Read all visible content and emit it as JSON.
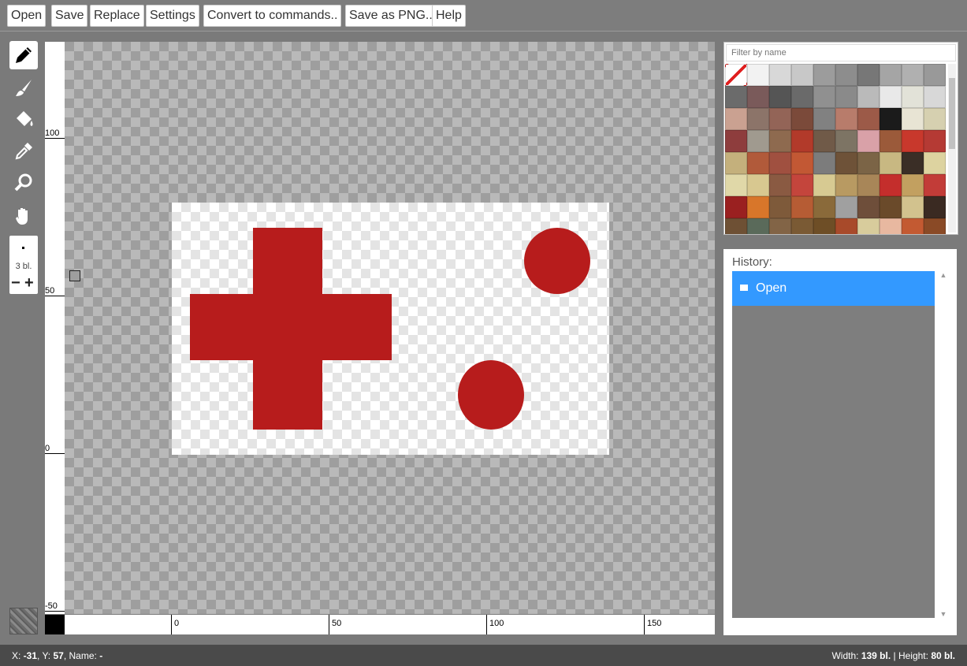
{
  "menu": {
    "open": "Open",
    "save": "Save",
    "replace": "Replace",
    "settings": "Settings",
    "convert": "Convert to commands..",
    "save_png": "Save as PNG..",
    "help": "Help"
  },
  "tools": {
    "icons": [
      "pencil-icon",
      "brush-icon",
      "fill-bucket-icon",
      "eyedropper-icon",
      "magnifier-icon",
      "hand-icon"
    ],
    "brush_size_label": "3 bl.",
    "minus": "−",
    "plus": "+"
  },
  "rulers": {
    "vertical_labels": [
      "100",
      "50",
      "0",
      "-50"
    ],
    "horizontal_labels": [
      "0",
      "50",
      "100",
      "150"
    ]
  },
  "colors": {
    "paint": "#b71c1c",
    "selected_swatch": "#000000",
    "history_highlight": "#3399ff"
  },
  "palette": {
    "filter_placeholder": "Filter by name",
    "tile_colors": [
      "#ffffff",
      "#f2f2f2",
      "#d8d8d8",
      "#c8c8c8",
      "#9c9c9c",
      "#8d8d8d",
      "#777777",
      "#a5a5a5",
      "#b0b0b0",
      "#999999",
      "#6b6b6b",
      "#7a5a5a",
      "#555555",
      "#6a6a6a",
      "#909090",
      "#8a8a8a",
      "#bababa",
      "#e9e9e9",
      "#e2e2d8",
      "#d8d8d8",
      "#caa191",
      "#8c7469",
      "#936457",
      "#7b4a3a",
      "#818181",
      "#b87c6b",
      "#9c5a48",
      "#1b1b1b",
      "#e8e4d4",
      "#d6d0b0",
      "#8e3d3d",
      "#a09a8f",
      "#8e6a4f",
      "#b23a2a",
      "#705a48",
      "#7d7464",
      "#d9a1a8",
      "#9b5a3a",
      "#c8382c",
      "#b53a34",
      "#c4b07c",
      "#b15a3a",
      "#a05040",
      "#c25834",
      "#7c7c7c",
      "#6e5238",
      "#7b6446",
      "#c8b882",
      "#3a2e26",
      "#ddd3a0",
      "#e0d8a8",
      "#d8c890",
      "#8a5a42",
      "#c4453c",
      "#d7ca92",
      "#b89a62",
      "#a88658",
      "#c42e2c",
      "#c2a060",
      "#c23c38",
      "#9a2020",
      "#d8762a",
      "#7e5a3a",
      "#b65c34",
      "#8a6a3a",
      "#a0a0a0",
      "#6e4e3a",
      "#6a4a2a",
      "#d2c28e",
      "#3a2a22",
      "#6e5034",
      "#5a6a5a",
      "#826446",
      "#7a5a34",
      "#6e4e26",
      "#a84a2a",
      "#d8cc9c",
      "#e8b8a0",
      "#c35a32",
      "#8a4a26"
    ]
  },
  "history": {
    "title": "History:",
    "items": [
      "Open"
    ]
  },
  "status": {
    "x_label": "X: ",
    "x_value": "-31",
    "y_label": ", Y: ",
    "y_value": "57",
    "name_label": ", Name: ",
    "name_value": "-",
    "width_label": "Width: ",
    "width_value": "139 bl.",
    "height_label": " | Height: ",
    "height_value": "80 bl."
  }
}
